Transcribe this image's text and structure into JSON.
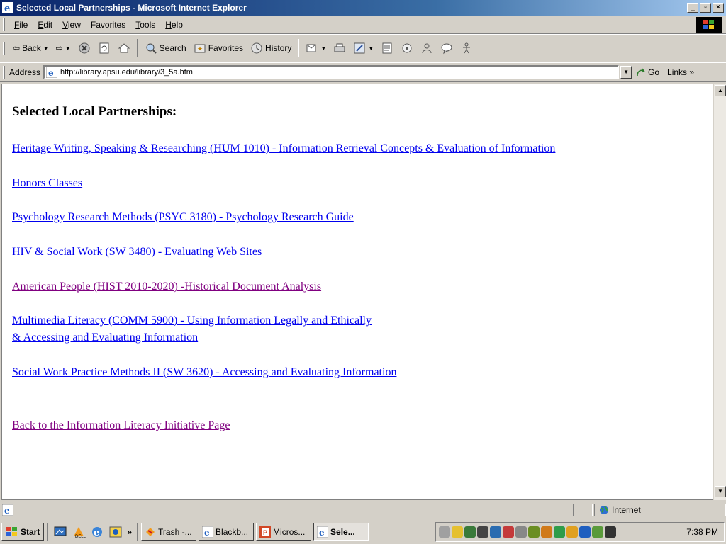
{
  "window": {
    "title": "Selected Local Partnerships - Microsoft Internet Explorer",
    "minimize": "_",
    "maximize": "▫",
    "close": "×"
  },
  "menu": {
    "items": [
      {
        "key": "F",
        "rest": "ile"
      },
      {
        "key": "E",
        "rest": "dit"
      },
      {
        "key": "V",
        "rest": "iew"
      },
      {
        "key": "Fa",
        "rest": "vorites",
        "underline_second": true
      },
      {
        "key": "T",
        "rest": "ools"
      },
      {
        "key": "H",
        "rest": "elp"
      }
    ],
    "labels": [
      "File",
      "Edit",
      "View",
      "Favorites",
      "Tools",
      "Help"
    ]
  },
  "toolbar": {
    "back": "Back",
    "search": "Search",
    "favorites": "Favorites",
    "history": "History"
  },
  "address": {
    "label": "Address",
    "url": "http://library.apsu.edu/library/3_5a.htm",
    "go": "Go",
    "links": "Links"
  },
  "page": {
    "heading": "Selected Local Partnerships:",
    "links": [
      {
        "text": "Heritage Writing, Speaking & Researching (HUM 1010) - Information Retrieval Concepts & Evaluation of Information",
        "visited": false
      },
      {
        "text": "Honors Classes",
        "visited": false
      },
      {
        "text": "Psychology Research Methods (PSYC 3180) - Psychology Research Guide",
        "visited": false
      },
      {
        "text": "HIV & Social Work (SW 3480) - Evaluating Web Sites",
        "visited": false
      },
      {
        "text": "American People (HIST 2010-2020) -Historical Document Analysis",
        "visited": true
      },
      {
        "text": "Multimedia Literacy (COMM 5900) - Using Information Legally and Ethically",
        "text2": "& Accessing and Evaluating Information",
        "visited": false
      },
      {
        "text": "Social Work Practice Methods II (SW 3620) - Accessing and Evaluating Information",
        "visited": false
      },
      {
        "text": "Back to the Information Literacy Initiative Page",
        "visited": true
      }
    ],
    "link_color": "#0000ee",
    "visited_color": "#800080"
  },
  "status": {
    "zone": "Internet"
  },
  "taskbar": {
    "start": "Start",
    "tasks": [
      "Trash -...",
      "Blackb...",
      "Micros...",
      "Sele..."
    ],
    "clock": "7:38 PM"
  }
}
